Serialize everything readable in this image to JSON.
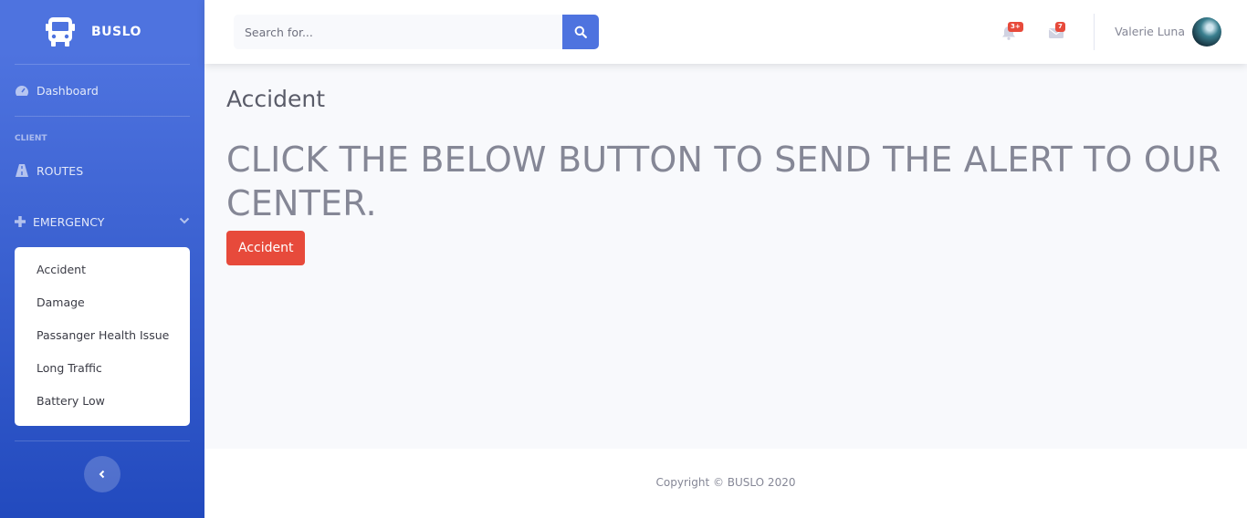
{
  "brand": {
    "name": "BUSLO",
    "icon": "bus-icon"
  },
  "sidebar": {
    "dashboard": {
      "label": "Dashboard",
      "icon": "tachometer-icon"
    },
    "heading": "CLIENT",
    "routes": {
      "label": "ROUTES",
      "icon": "road-icon"
    },
    "emergency": {
      "label": "EMERGENCY",
      "icon": "plus-icon",
      "items": [
        {
          "label": "Accident"
        },
        {
          "label": "Damage"
        },
        {
          "label": "Passanger Health Issue"
        },
        {
          "label": "Long Traffic"
        },
        {
          "label": "Battery Low"
        }
      ]
    }
  },
  "topbar": {
    "search_placeholder": "Search for...",
    "alerts_badge": "3+",
    "messages_badge": "7",
    "user_name": "Valerie Luna"
  },
  "main": {
    "title": "Accident",
    "alert_text": "CLICK THE BELOW BUTTON TO SEND THE ALERT TO OUR CENTER.",
    "button_label": "Accident"
  },
  "footer": {
    "copyright": "Copyright © BUSLO 2020"
  },
  "colors": {
    "primary": "#4e73df",
    "danger": "#e74a3b",
    "text": "#858796"
  }
}
